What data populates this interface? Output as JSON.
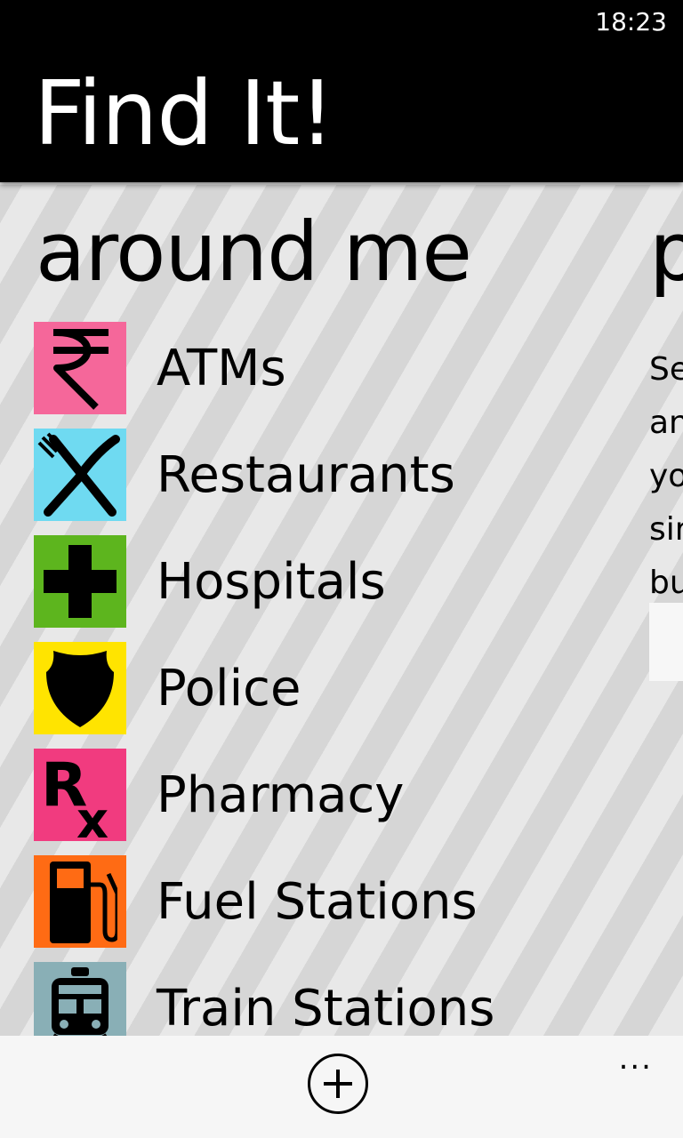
{
  "status_bar": {
    "time": "18:23"
  },
  "header": {
    "app_title": "Find It!"
  },
  "panorama": {
    "section_title": "around me",
    "next_section_title_peek": "p",
    "next_section_text_peek": [
      "Se",
      "an",
      "yo",
      "sir",
      "bu"
    ]
  },
  "categories": [
    {
      "label": "ATMs",
      "color": "#f5679a",
      "icon": "rupee-icon"
    },
    {
      "label": "Restaurants",
      "color": "#6fdaf1",
      "icon": "fork-knife-icon"
    },
    {
      "label": "Hospitals",
      "color": "#5db51e",
      "icon": "cross-icon"
    },
    {
      "label": "Police",
      "color": "#ffe400",
      "icon": "badge-icon"
    },
    {
      "label": "Pharmacy",
      "color": "#f13b7f",
      "icon": "rx-icon"
    },
    {
      "label": "Fuel Stations",
      "color": "#ff6b14",
      "icon": "fuel-pump-icon"
    },
    {
      "label": "Train Stations",
      "color": "#89afb6",
      "icon": "train-icon"
    }
  ],
  "app_bar": {
    "add_icon": "add-circle-icon",
    "more_label": "..."
  }
}
